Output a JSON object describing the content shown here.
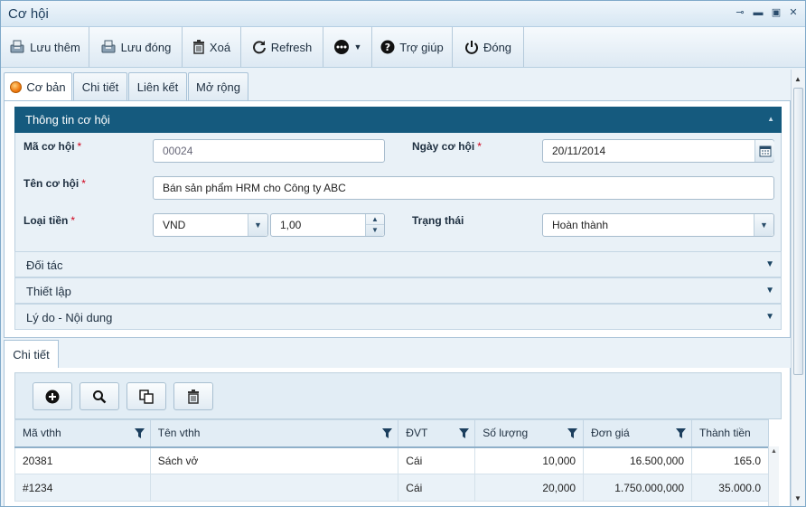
{
  "window": {
    "title": "Cơ hội"
  },
  "toolbar": {
    "save_new": "Lưu thêm",
    "save_close": "Lưu đóng",
    "delete": "Xoá",
    "refresh": "Refresh",
    "help": "Trợ giúp",
    "close": "Đóng"
  },
  "tabs": [
    "Cơ bản",
    "Chi tiết",
    "Liên kết",
    "Mở rộng"
  ],
  "section": {
    "title": "Thông tin cơ hội",
    "fields": {
      "code_label": "Mã cơ hội",
      "code_value": "00024",
      "date_label": "Ngày cơ hội",
      "date_value": "20/11/2014",
      "name_label": "Tên cơ hội",
      "name_value": "Bán sản phẩm HRM cho Công ty ABC",
      "currency_label": "Loại tiền",
      "currency_value": "VND",
      "rate_value": "1,00",
      "status_label": "Trạng thái",
      "status_value": "Hoàn thành",
      "required_mark": "*"
    }
  },
  "accordion": [
    "Đối tác",
    "Thiết lập",
    "Lý do - Nội dung"
  ],
  "detail": {
    "tab": "Chi tiết",
    "columns": [
      "Mã vthh",
      "Tên vthh",
      "ĐVT",
      "Số lượng",
      "Đơn giá",
      "Thành tiền"
    ],
    "rows": [
      [
        "20381",
        "Sách vở",
        "Cái",
        "10,000",
        "16.500,000",
        "165.0"
      ],
      [
        "#1234",
        "",
        "Cái",
        "20,000",
        "1.750.000,000",
        "35.000.0"
      ]
    ]
  },
  "colors": {
    "section_header": "#155a7e",
    "accent_tab": "#f07a10"
  }
}
